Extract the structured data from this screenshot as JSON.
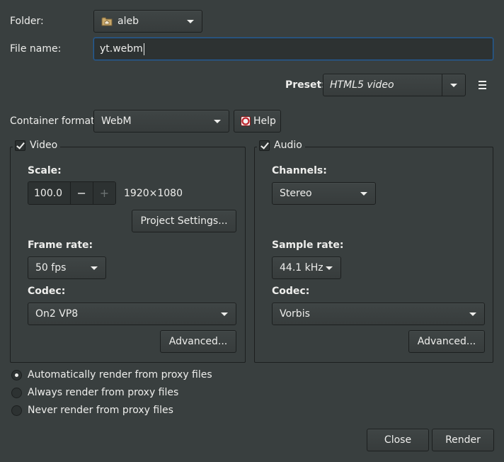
{
  "folder": {
    "label": "Folder:",
    "value": "aleb",
    "icon": "folder-home-icon"
  },
  "filename": {
    "label": "File name:",
    "value": "yt.webm"
  },
  "preset": {
    "label": "Preset:",
    "value": "HTML5 video",
    "menu_icon": "hamburger-menu-icon"
  },
  "container": {
    "label": "Container format:",
    "value": "WebM",
    "help_label": "Help",
    "help_icon": "help-lifebuoy-icon"
  },
  "video": {
    "title": "Video",
    "checked": true,
    "scale_label": "Scale:",
    "scale_value": "100.0",
    "resolution": "1920×1080",
    "project_settings_label": "Project Settings...",
    "framerate_label": "Frame rate:",
    "framerate_value": "50 fps",
    "codec_label": "Codec:",
    "codec_value": "On2 VP8",
    "advanced_label": "Advanced..."
  },
  "audio": {
    "title": "Audio",
    "checked": true,
    "channels_label": "Channels:",
    "channels_value": "Stereo",
    "samplerate_label": "Sample rate:",
    "samplerate_value": "44.1 kHz",
    "codec_label": "Codec:",
    "codec_value": "Vorbis",
    "advanced_label": "Advanced..."
  },
  "proxy": {
    "options": [
      {
        "label": "Automatically render from proxy files",
        "selected": true
      },
      {
        "label": "Always render from proxy files",
        "selected": false
      },
      {
        "label": "Never render from proxy files",
        "selected": false
      }
    ]
  },
  "actions": {
    "close_label": "Close",
    "render_label": "Render"
  },
  "colors": {
    "background": "#393f3f",
    "border": "#1c1f1f",
    "focus": "#215d9c",
    "text": "#eeeeec"
  }
}
